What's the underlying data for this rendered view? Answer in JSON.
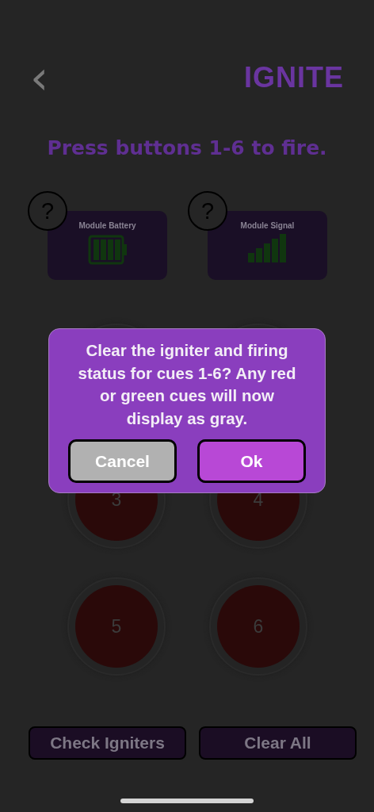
{
  "header": {
    "back": "‹",
    "logo": "IGNITE"
  },
  "title": "Press buttons 1-6 to fire.",
  "status_cards": [
    {
      "kind": "battery",
      "label": "Module Battery",
      "help": "?"
    },
    {
      "kind": "signal",
      "label": "Module Signal",
      "help": "?"
    }
  ],
  "cues": [
    {
      "label": "3"
    },
    {
      "label": "4"
    },
    {
      "label": "5"
    },
    {
      "label": "6"
    }
  ],
  "actions": [
    "Check Igniters",
    "Clear All"
  ],
  "dialog": {
    "message": "Clear the igniter and firing status for cues 1-6? Any red or green cues will now display as gray.",
    "buttons": [
      {
        "label": "Cancel",
        "kind": "cancel"
      },
      {
        "label": "Ok",
        "kind": "confirm"
      }
    ]
  }
}
